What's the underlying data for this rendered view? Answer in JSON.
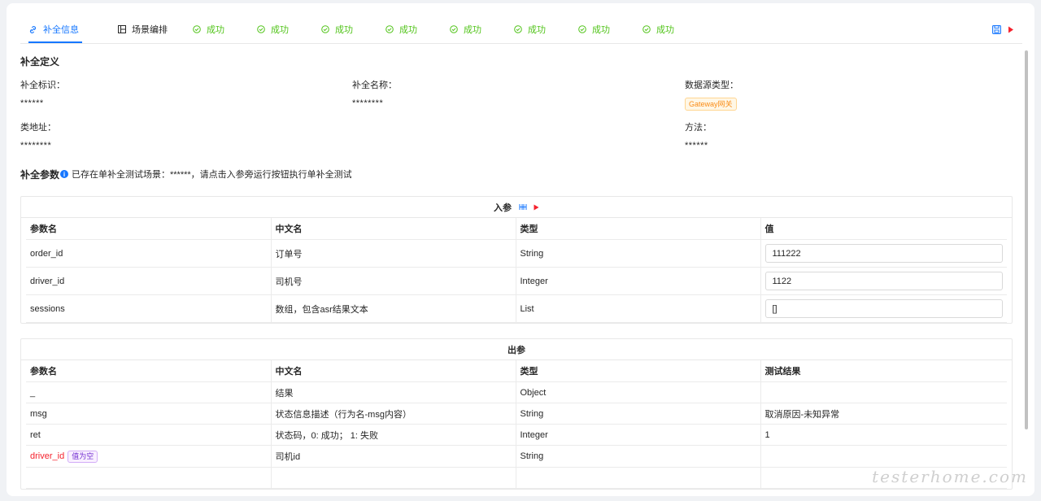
{
  "tabs": [
    {
      "label": "补全信息",
      "type": "active",
      "icon": "link-icon"
    },
    {
      "label": "场景编排",
      "type": "normal",
      "icon": "layout-icon"
    },
    {
      "label": "成功",
      "type": "success",
      "icon": "check-circle-icon"
    },
    {
      "label": "成功",
      "type": "success",
      "icon": "check-circle-icon"
    },
    {
      "label": "成功",
      "type": "success",
      "icon": "check-circle-icon"
    },
    {
      "label": "成功",
      "type": "success",
      "icon": "check-circle-icon"
    },
    {
      "label": "成功",
      "type": "success",
      "icon": "check-circle-icon"
    },
    {
      "label": "成功",
      "type": "success",
      "icon": "check-circle-icon"
    },
    {
      "label": "成功",
      "type": "success",
      "icon": "check-circle-icon"
    },
    {
      "label": "成功",
      "type": "success",
      "icon": "check-circle-icon"
    }
  ],
  "definition": {
    "title": "补全定义",
    "id_label": "补全标识：",
    "id_value": "******",
    "name_label": "补全名称：",
    "name_value": "********",
    "source_label": "数据源类型：",
    "source_tag": "Gateway网关",
    "class_label": "类地址：",
    "class_value": "********",
    "method_label": "方法：",
    "method_value": "******"
  },
  "params": {
    "title": "补全参数",
    "notice": "已存在单补全测试场景：******，请点击入参旁运行按钮执行单补全测试"
  },
  "input": {
    "title": "入参",
    "headers": [
      "参数名",
      "中文名",
      "类型",
      "值"
    ],
    "rows": [
      {
        "name": "order_id",
        "cn": "订单号",
        "type": "String",
        "value": "111222"
      },
      {
        "name": "driver_id",
        "cn": "司机号",
        "type": "Integer",
        "value": "1122"
      },
      {
        "name": "sessions",
        "cn": "数组，包含asr结果文本",
        "type": "List",
        "value": "[]"
      }
    ]
  },
  "output": {
    "title": "出参",
    "headers": [
      "参数名",
      "中文名",
      "类型",
      "测试结果"
    ],
    "rows": [
      {
        "name": "_",
        "cn": "结果",
        "type": "Object",
        "result": ""
      },
      {
        "name": "msg",
        "cn": "状态信息描述（行为名-msg内容）",
        "type": "String",
        "result": "取消原因-未知异常"
      },
      {
        "name": "ret",
        "cn": "状态码，0: 成功；  1: 失败",
        "type": "Integer",
        "result": "1"
      },
      {
        "name": "driver_id",
        "cn": "司机id",
        "type": "String",
        "result": "",
        "tag": "值为空"
      }
    ]
  },
  "watermark": "testerhome.com",
  "colors": {
    "primary": "#1677ff",
    "success": "#52c41a",
    "danger": "#f5222d",
    "warning": "#fa8c16"
  }
}
